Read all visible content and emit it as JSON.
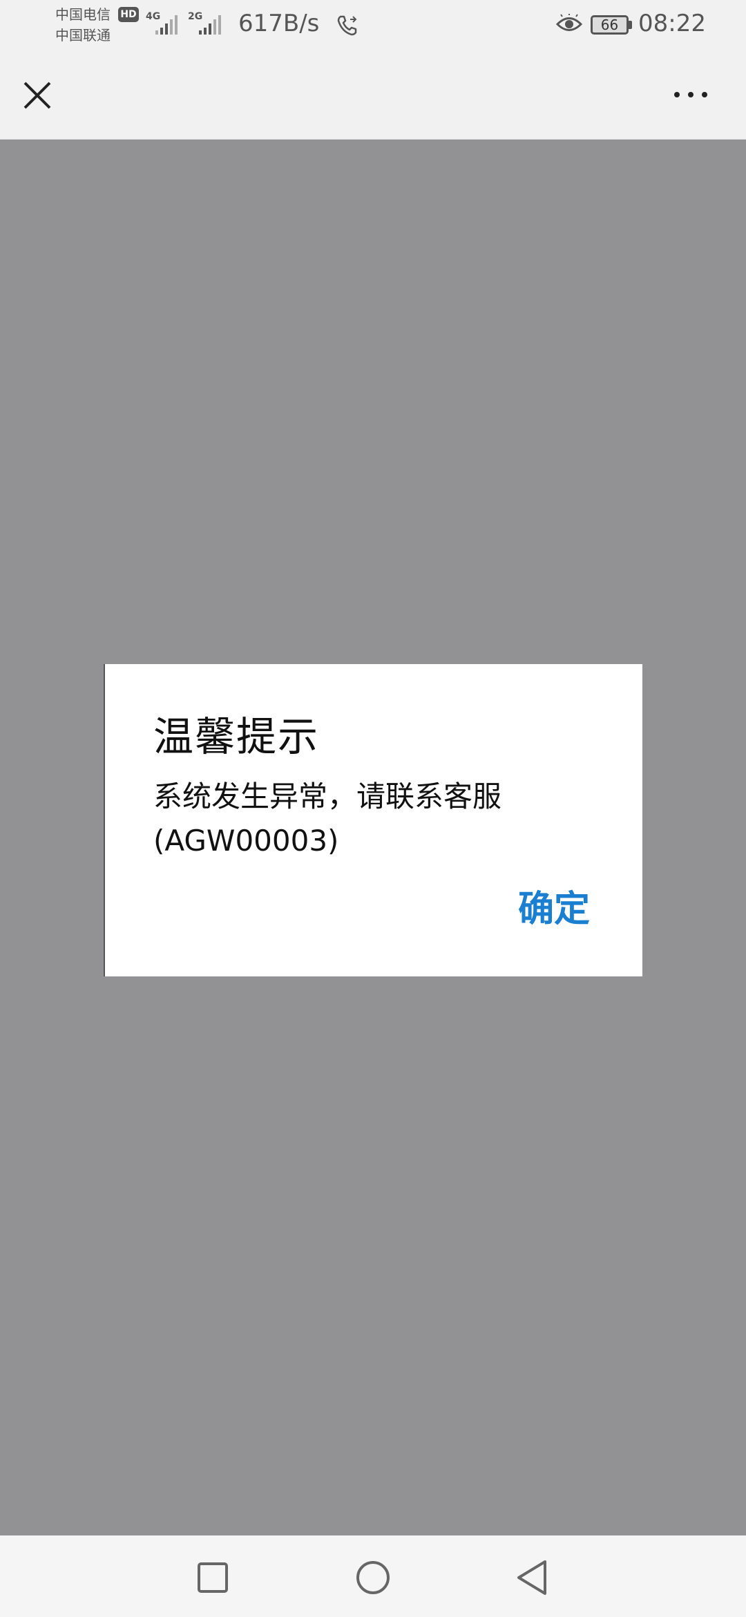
{
  "status_bar": {
    "carrier_1": "中国电信",
    "carrier_2": "中国联通",
    "hd_badge": "HD",
    "network_1": "4G",
    "network_2": "2G",
    "speed": "617B/s",
    "battery": "66",
    "time": "08:22",
    "icons": [
      "phone-call-icon",
      "eye-icon",
      "battery-icon",
      "signal-icon"
    ]
  },
  "nav_bar": {
    "icons": [
      "close-icon",
      "more-icon"
    ]
  },
  "dialog": {
    "title": "温馨提示",
    "message_line_1": "系统发生异常，请联系客服",
    "message_line_2": "(AGW00003)",
    "ok_label": "确定",
    "accent_color": "#1a7fd0"
  },
  "bottom_nav": {
    "icons": [
      "recent-apps-icon",
      "home-icon",
      "back-icon"
    ]
  }
}
